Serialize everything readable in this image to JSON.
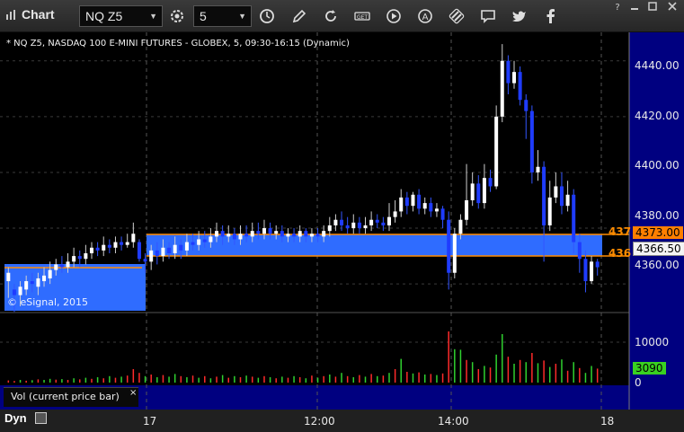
{
  "toolbar": {
    "app_title": "Chart",
    "symbol_value": "NQ Z5",
    "interval_value": "5"
  },
  "chart": {
    "header": "* NQ Z5, NASDAQ 100 E-MINI FUTURES - GLOBEX, 5, 09:30-16:15 (Dynamic)",
    "copyright": "© eSignal, 2015",
    "price_ticks": [
      "4440.00",
      "4420.00",
      "4400.00",
      "4380.00",
      "4360.00"
    ],
    "price_high_badge": "4373.00",
    "price_last_badge": "4366.50",
    "edge_label_high": "437",
    "edge_label_low": "436",
    "volume_ticks": [
      "10000",
      "0"
    ],
    "volume_last_badge": "3090",
    "volume_legend": "Vol (current price bar)",
    "volume_close": "×",
    "time_ticks": [
      "17",
      "12:00",
      "14:00",
      "18"
    ],
    "dyn_label": "Dyn",
    "colors": {
      "background": "#000000",
      "axis_bg": "#000080",
      "band": "#2f6cff",
      "band_line": "#ff8c00",
      "up_candle": "#ffffff",
      "down_candle": "#1f3cff",
      "vol_up": "#2fd12f",
      "vol_down": "#ff2a2a"
    }
  },
  "chart_data": {
    "type": "candlestick",
    "ylim": [
      4352,
      4447
    ],
    "levels": {
      "high": 4373.0,
      "low": 4363.5,
      "last": 4366.5
    },
    "candles": [
      [
        4361,
        4364,
        4355,
        4366
      ],
      [
        4358,
        4356,
        4350,
        4360
      ],
      [
        4356,
        4359,
        4352,
        4361
      ],
      [
        4358,
        4361,
        4356,
        4363
      ],
      [
        4361,
        4360,
        4357,
        4364
      ],
      [
        4359,
        4362,
        4356,
        4364
      ],
      [
        4361,
        4363,
        4359,
        4366
      ],
      [
        4362,
        4365,
        4360,
        4368
      ],
      [
        4365,
        4367,
        4363,
        4369
      ],
      [
        4367,
        4366,
        4364,
        4370
      ],
      [
        4366,
        4368,
        4364,
        4371
      ],
      [
        4368,
        4370,
        4366,
        4373
      ],
      [
        4370,
        4369,
        4366,
        4372
      ],
      [
        4369,
        4371,
        4367,
        4374
      ],
      [
        4371,
        4373,
        4369,
        4375
      ],
      [
        4373,
        4372,
        4370,
        4375
      ],
      [
        4372,
        4374,
        4370,
        4377
      ],
      [
        4374,
        4373,
        4371,
        4376
      ],
      [
        4373,
        4375,
        4371,
        4377
      ],
      [
        4375,
        4374,
        4372,
        4377
      ],
      [
        4374,
        4375,
        4373,
        4378
      ],
      [
        4375,
        4378,
        4373,
        4382
      ],
      [
        4375,
        4369,
        4368,
        4376
      ],
      [
        4369,
        4368,
        4364,
        4371
      ],
      [
        4368,
        4372,
        4365,
        4374
      ],
      [
        4372,
        4370,
        4367,
        4375
      ],
      [
        4370,
        4373,
        4368,
        4376
      ],
      [
        4373,
        4371,
        4369,
        4375
      ],
      [
        4371,
        4374,
        4369,
        4377
      ],
      [
        4374,
        4372,
        4369,
        4376
      ],
      [
        4372,
        4375,
        4370,
        4378
      ],
      [
        4375,
        4374,
        4372,
        4378
      ],
      [
        4374,
        4376,
        4372,
        4379
      ],
      [
        4376,
        4375,
        4373,
        4379
      ],
      [
        4375,
        4377,
        4373,
        4380
      ],
      [
        4377,
        4379,
        4375,
        4382
      ],
      [
        4379,
        4377,
        4374,
        4381
      ],
      [
        4377,
        4378,
        4375,
        4381
      ],
      [
        4378,
        4376,
        4374,
        4380
      ],
      [
        4376,
        4378,
        4374,
        4381
      ],
      [
        4378,
        4377,
        4375,
        4381
      ],
      [
        4377,
        4379,
        4375,
        4382
      ],
      [
        4379,
        4378,
        4376,
        4382
      ],
      [
        4378,
        4380,
        4376,
        4383
      ],
      [
        4380,
        4378,
        4376,
        4382
      ],
      [
        4378,
        4379,
        4376,
        4381
      ],
      [
        4379,
        4377,
        4375,
        4381
      ],
      [
        4377,
        4378,
        4375,
        4380
      ],
      [
        4378,
        4377,
        4375,
        4380
      ],
      [
        4377,
        4379,
        4375,
        4381
      ],
      [
        4379,
        4377,
        4375,
        4380
      ],
      [
        4377,
        4378,
        4375,
        4380
      ],
      [
        4378,
        4377,
        4375,
        4380
      ],
      [
        4377,
        4379,
        4375,
        4381
      ],
      [
        4379,
        4381,
        4377,
        4384
      ],
      [
        4381,
        4383,
        4379,
        4385
      ],
      [
        4383,
        4381,
        4379,
        4386
      ],
      [
        4381,
        4380,
        4378,
        4384
      ],
      [
        4380,
        4382,
        4378,
        4385
      ],
      [
        4382,
        4380,
        4378,
        4384
      ],
      [
        4380,
        4381,
        4378,
        4384
      ],
      [
        4381,
        4383,
        4379,
        4386
      ],
      [
        4383,
        4382,
        4380,
        4385
      ],
      [
        4382,
        4381,
        4379,
        4384
      ],
      [
        4381,
        4384,
        4379,
        4389
      ],
      [
        4384,
        4386,
        4382,
        4390
      ],
      [
        4386,
        4391,
        4384,
        4394
      ],
      [
        4391,
        4388,
        4385,
        4393
      ],
      [
        4388,
        4392,
        4386,
        4393
      ],
      [
        4392,
        4387,
        4385,
        4394
      ],
      [
        4387,
        4389,
        4385,
        4391
      ],
      [
        4389,
        4386,
        4384,
        4391
      ],
      [
        4386,
        4387,
        4384,
        4389
      ],
      [
        4387,
        4383,
        4380,
        4388
      ],
      [
        4383,
        4364,
        4358,
        4386
      ],
      [
        4364,
        4378,
        4362,
        4380
      ],
      [
        4378,
        4383,
        4376,
        4385
      ],
      [
        4383,
        4390,
        4381,
        4403
      ],
      [
        4390,
        4396,
        4388,
        4400
      ],
      [
        4396,
        4389,
        4387,
        4399
      ],
      [
        4389,
        4398,
        4387,
        4403
      ],
      [
        4398,
        4395,
        4393,
        4401
      ],
      [
        4395,
        4420,
        4394,
        4424
      ],
      [
        4420,
        4440,
        4418,
        4446
      ],
      [
        4440,
        4432,
        4428,
        4442
      ],
      [
        4432,
        4436,
        4430,
        4440
      ],
      [
        4436,
        4426,
        4424,
        4438
      ],
      [
        4426,
        4422,
        4412,
        4428
      ],
      [
        4422,
        4400,
        4396,
        4424
      ],
      [
        4400,
        4402,
        4397,
        4408
      ],
      [
        4402,
        4381,
        4368,
        4404
      ],
      [
        4381,
        4391,
        4379,
        4397
      ],
      [
        4391,
        4395,
        4389,
        4400
      ],
      [
        4395,
        4388,
        4385,
        4400
      ],
      [
        4388,
        4392,
        4386,
        4397
      ],
      [
        4392,
        4375,
        4371,
        4394
      ],
      [
        4375,
        4369,
        4364,
        4378
      ],
      [
        4369,
        4361,
        4357,
        4372
      ],
      [
        4361,
        4368,
        4360,
        4370
      ],
      [
        4368,
        4366,
        4363,
        4369
      ]
    ],
    "volume": [
      [
        400,
        0
      ],
      [
        300,
        0
      ],
      [
        500,
        1
      ],
      [
        350,
        0
      ],
      [
        450,
        1
      ],
      [
        600,
        0
      ],
      [
        500,
        1
      ],
      [
        700,
        1
      ],
      [
        550,
        0
      ],
      [
        650,
        1
      ],
      [
        500,
        0
      ],
      [
        800,
        1
      ],
      [
        600,
        0
      ],
      [
        900,
        1
      ],
      [
        700,
        0
      ],
      [
        1000,
        1
      ],
      [
        800,
        0
      ],
      [
        1200,
        1
      ],
      [
        900,
        0
      ],
      [
        1100,
        1
      ],
      [
        1300,
        0
      ],
      [
        2500,
        0
      ],
      [
        1800,
        0
      ],
      [
        1200,
        1
      ],
      [
        1500,
        0
      ],
      [
        1000,
        1
      ],
      [
        1400,
        0
      ],
      [
        1100,
        1
      ],
      [
        1600,
        1
      ],
      [
        1200,
        0
      ],
      [
        1000,
        1
      ],
      [
        1300,
        0
      ],
      [
        900,
        1
      ],
      [
        1200,
        0
      ],
      [
        800,
        1
      ],
      [
        1100,
        0
      ],
      [
        1400,
        1
      ],
      [
        900,
        0
      ],
      [
        1200,
        1
      ],
      [
        1000,
        0
      ],
      [
        1300,
        1
      ],
      [
        1100,
        0
      ],
      [
        900,
        1
      ],
      [
        1200,
        0
      ],
      [
        1000,
        1
      ],
      [
        800,
        0
      ],
      [
        1100,
        1
      ],
      [
        900,
        0
      ],
      [
        1200,
        1
      ],
      [
        1000,
        0
      ],
      [
        800,
        1
      ],
      [
        1300,
        0
      ],
      [
        900,
        1
      ],
      [
        1200,
        0
      ],
      [
        1500,
        1
      ],
      [
        1100,
        0
      ],
      [
        1800,
        1
      ],
      [
        1200,
        0
      ],
      [
        1000,
        1
      ],
      [
        1400,
        0
      ],
      [
        1100,
        1
      ],
      [
        1600,
        0
      ],
      [
        1200,
        1
      ],
      [
        1300,
        0
      ],
      [
        1800,
        1
      ],
      [
        2500,
        0
      ],
      [
        4400,
        1
      ],
      [
        2000,
        0
      ],
      [
        1700,
        1
      ],
      [
        1900,
        0
      ],
      [
        1500,
        1
      ],
      [
        1600,
        0
      ],
      [
        1400,
        1
      ],
      [
        1700,
        0
      ],
      [
        9500,
        0
      ],
      [
        6200,
        1
      ],
      [
        6100,
        1
      ],
      [
        4200,
        0
      ],
      [
        3800,
        1
      ],
      [
        2500,
        0
      ],
      [
        3100,
        1
      ],
      [
        2800,
        0
      ],
      [
        5200,
        1
      ],
      [
        9000,
        1
      ],
      [
        4800,
        0
      ],
      [
        3500,
        1
      ],
      [
        4200,
        0
      ],
      [
        3800,
        1
      ],
      [
        5500,
        0
      ],
      [
        3600,
        1
      ],
      [
        4100,
        0
      ],
      [
        2900,
        1
      ],
      [
        3500,
        0
      ],
      [
        4300,
        1
      ],
      [
        2200,
        0
      ],
      [
        3800,
        1
      ],
      [
        2700,
        0
      ],
      [
        1800,
        1
      ],
      [
        3090,
        1
      ],
      [
        2600,
        0
      ]
    ]
  }
}
